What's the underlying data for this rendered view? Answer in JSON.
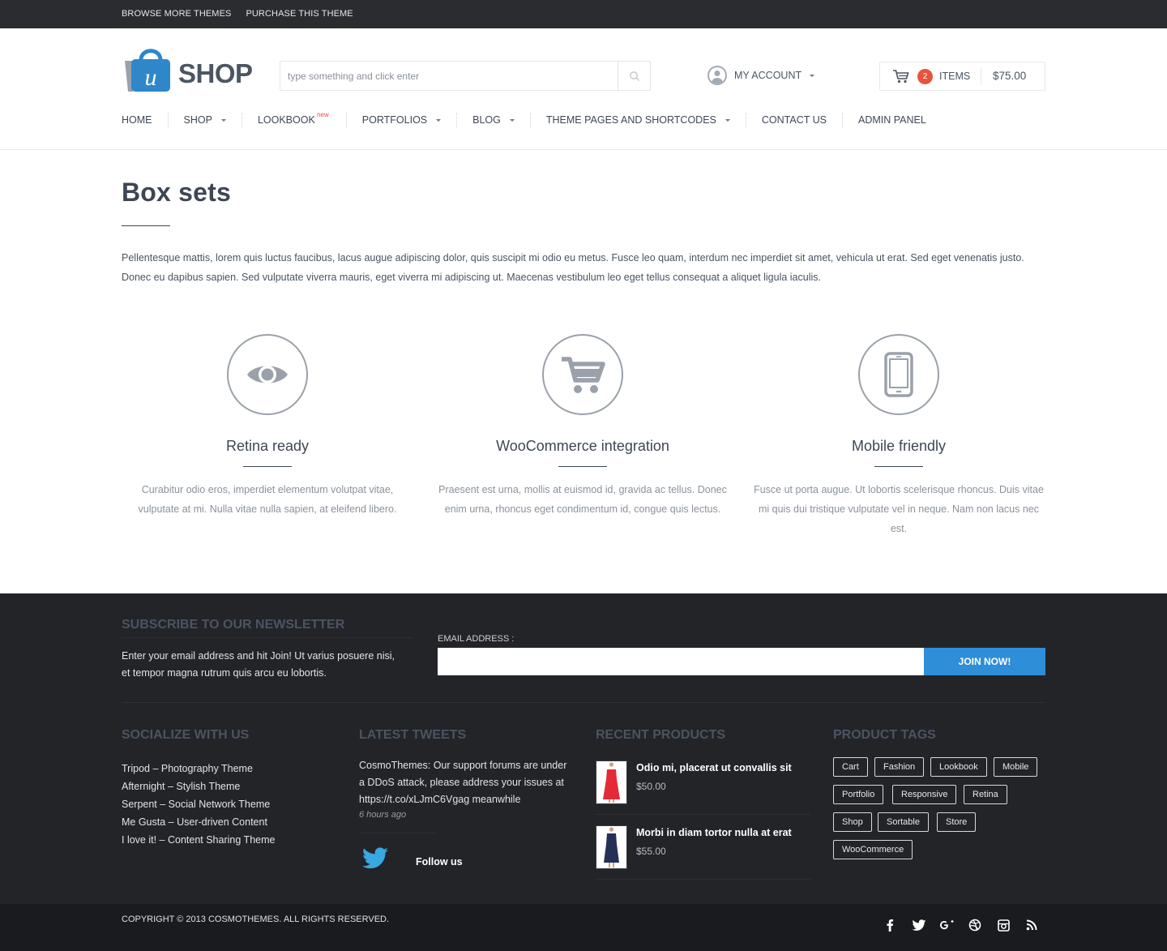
{
  "topbar": {
    "browse": "BROWSE MORE THEMES",
    "purchase": "PURCHASE THIS THEME"
  },
  "logo": {
    "text": "SHOP",
    "mark": "u"
  },
  "search": {
    "placeholder": "type something and click enter"
  },
  "account": {
    "label": "MY ACCOUNT"
  },
  "cart": {
    "count": "2",
    "items_label": "ITEMS",
    "total": "$75.00"
  },
  "nav": {
    "home": "HOME",
    "shop": "SHOP",
    "lookbook": "LOOKBOOK",
    "lookbook_badge": "new",
    "portfolios": "PORTFOLIOS",
    "blog": "BLOG",
    "theme_pages": "THEME PAGES AND SHORTCODES",
    "contact": "CONTACT US",
    "admin": "ADMIN PANEL"
  },
  "page": {
    "title": "Box sets",
    "intro": "Pellentesque mattis, lorem quis luctus faucibus, lacus augue adipiscing dolor, quis suscipit mi odio eu metus. Fusce leo quam, interdum nec imperdiet sit amet, vehicula ut erat. Sed eget venenatis justo. Donec eu dapibus sapien. Sed vulputate viverra mauris, eget viverra mi adipiscing ut. Maecenas vestibulum leo eget tellus consequat a aliquet ligula iaculis."
  },
  "features": [
    {
      "icon": "eye-icon",
      "title": "Retina ready",
      "text": "Curabitur odio eros, imperdiet elementum volutpat vitae, vulputate at mi. Nulla vitae nulla sapien, at eleifend libero."
    },
    {
      "icon": "shopping-cart-icon",
      "title": "WooCommerce integration",
      "text": "Praesent est urna, mollis at euismod id, gravida ac tellus. Donec enim urna, rhoncus eget condimentum id, congue quis lectus."
    },
    {
      "icon": "mobile-phone-icon",
      "title": "Mobile friendly",
      "text": "Fusce ut porta augue. Ut lobortis scelerisque rhoncus. Duis vitae mi quis dui tristique vulputate vel in neque. Nam non lacus nec est."
    }
  ],
  "newsletter": {
    "title": "SUBSCRIBE TO OUR NEWSLETTER",
    "text": "Enter your email address and hit Join! Ut varius posuere nisi, et tempor magna rutrum quis arcu eu lobortis.",
    "email_label": "EMAIL ADDRESS :",
    "email_value": "",
    "button": "JOIN NOW!"
  },
  "socialize": {
    "title": "SOCIALIZE WITH US",
    "links": [
      "Tripod – Photography Theme",
      "Afternight – Stylish Theme",
      "Serpent – Social Network Theme",
      "Me Gusta – User-driven Content",
      "I love it! – Content Sharing Theme"
    ]
  },
  "tweets": {
    "title": "LATEST TWEETS",
    "text": "CosmoThemes: Our support forums are under a DDoS attack, please address your issues at https://t.co/xLJmC6Vgag meanwhile",
    "time": "6 hours ago",
    "follow": "Follow us"
  },
  "recent_products": {
    "title": "RECENT PRODUCTS",
    "items": [
      {
        "name": "Odio mi, placerat ut convallis sit",
        "price": "$50.00",
        "color": "#e32b37"
      },
      {
        "name": "Morbi in diam tortor nulla at erat",
        "price": "$55.00",
        "color": "#253056"
      }
    ]
  },
  "product_tags": {
    "title": "PRODUCT TAGS",
    "tags": [
      "Cart",
      "Fashion",
      "Lookbook",
      "Mobile",
      "Portfolio",
      "Responsive",
      "Retina",
      "Shop",
      "Sortable",
      "Store",
      "WooCommerce"
    ]
  },
  "footer": {
    "copyright": "COPYRIGHT © 2013 COSMOTHEMES. ALL RIGHTS RESERVED.",
    "social": [
      "facebook-icon",
      "twitter-icon",
      "google-plus-icon",
      "dribbble-icon",
      "instagram-icon",
      "rss-icon"
    ]
  },
  "colors": {
    "accent_blue": "#2e8ed8",
    "badge_red": "#e8533b",
    "footer_bg": "#232428",
    "topbar_bg": "#2b2c2f",
    "twitter_blue": "#3aa7e0"
  }
}
